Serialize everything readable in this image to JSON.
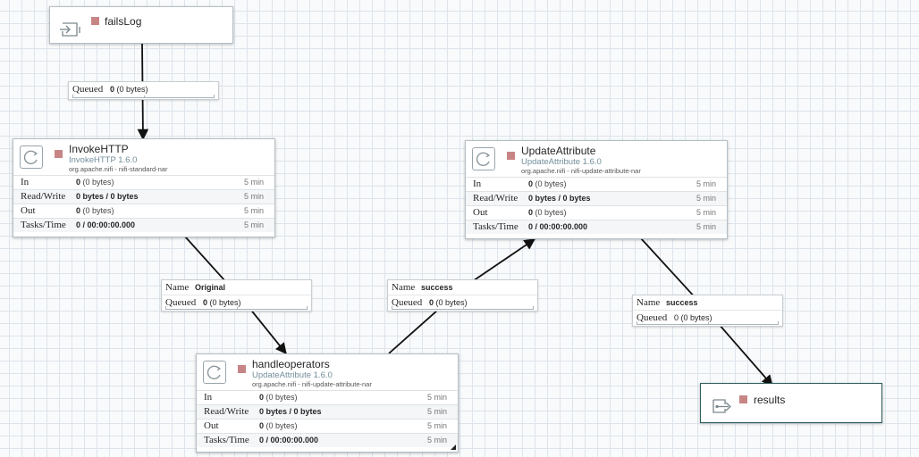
{
  "ports": {
    "input": {
      "name": "failsLog",
      "icon": "input-port-icon"
    },
    "output": {
      "name": "results",
      "icon": "output-port-icon"
    }
  },
  "processors": {
    "invokehttp": {
      "name": "InvokeHTTP",
      "type": "InvokeHTTP 1.6.0",
      "bundle": "org.apache.nifi - nifi-standard-nar",
      "stats": {
        "in_label": "In",
        "in_count": "0",
        "in_size": "(0 bytes)",
        "in_window": "5 min",
        "rw_label": "Read/Write",
        "rw_value": "0 bytes / 0 bytes",
        "rw_window": "5 min",
        "out_label": "Out",
        "out_count": "0",
        "out_size": "(0 bytes)",
        "out_window": "5 min",
        "tasks_label": "Tasks/Time",
        "tasks_value": "0 / 00:00:00.000",
        "tasks_window": "5 min"
      }
    },
    "updateattribute": {
      "name": "UpdateAttribute",
      "type": "UpdateAttribute 1.6.0",
      "bundle": "org.apache.nifi - nifi-update-attribute-nar",
      "stats": {
        "in_label": "In",
        "in_count": "0",
        "in_size": "(0 bytes)",
        "in_window": "5 min",
        "rw_label": "Read/Write",
        "rw_value": "0 bytes / 0 bytes",
        "rw_window": "5 min",
        "out_label": "Out",
        "out_count": "0",
        "out_size": "(0 bytes)",
        "out_window": "5 min",
        "tasks_label": "Tasks/Time",
        "tasks_value": "0 / 00:00:00.000",
        "tasks_window": "5 min"
      }
    },
    "handleoperators": {
      "name": "handleoperators",
      "type": "UpdateAttribute 1.6.0",
      "bundle": "org.apache.nifi - nifi-update-attribute-nar",
      "stats": {
        "in_label": "In",
        "in_count": "0",
        "in_size": "(0 bytes)",
        "in_window": "5 min",
        "rw_label": "Read/Write",
        "rw_value": "0 bytes / 0 bytes",
        "rw_window": "5 min",
        "out_label": "Out",
        "out_count": "0",
        "out_size": "(0 bytes)",
        "out_window": "5 min",
        "tasks_label": "Tasks/Time",
        "tasks_value": "0 / 00:00:00.000",
        "tasks_window": "5 min"
      }
    }
  },
  "connections": {
    "failslog_to_invoke": {
      "queued_label": "Queued",
      "queued_count": "0",
      "queued_size": "(0 bytes)"
    },
    "invoke_to_handle": {
      "name_label": "Name",
      "name_value": "Original",
      "queued_label": "Queued",
      "queued_count": "0",
      "queued_size": "(0 bytes)"
    },
    "handle_to_update": {
      "name_label": "Name",
      "name_value": "success",
      "queued_label": "Queued",
      "queued_count": "0",
      "queued_size": "(0 bytes)"
    },
    "update_to_results": {
      "name_label": "Name",
      "name_value": "success",
      "queued_label": "Queued",
      "queued_count": "0",
      "queued_size": "(0 bytes)"
    }
  },
  "colors": {
    "state_stopped": "#c78585",
    "link": "#111111",
    "grid": "#dde4ec"
  }
}
